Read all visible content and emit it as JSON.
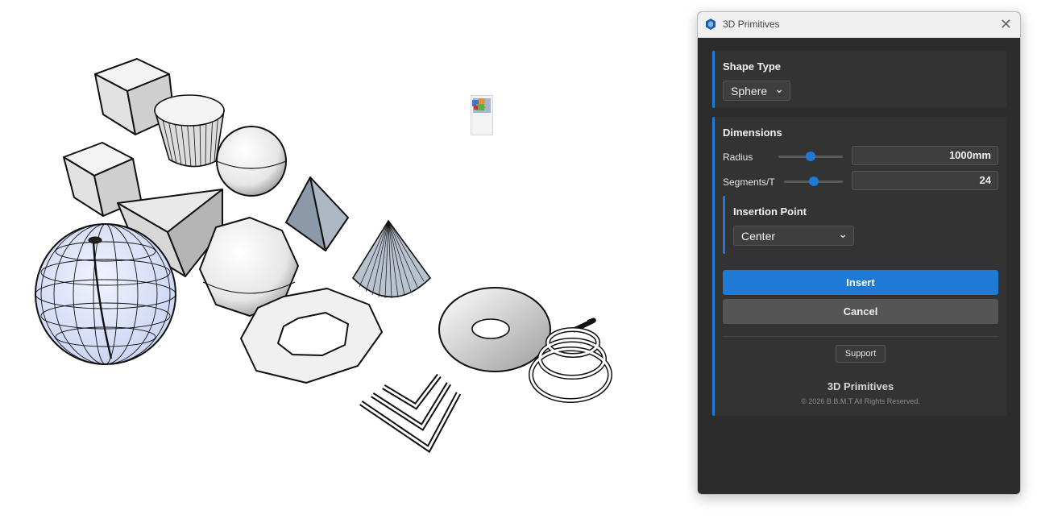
{
  "dialog": {
    "title": "3D Primitives",
    "shape_type": {
      "label": "Shape Type",
      "value": "Sphere"
    },
    "dimensions": {
      "label": "Dimensions",
      "radius": {
        "label": "Radius",
        "value": "1000mm",
        "slider_fraction": 0.5
      },
      "segments": {
        "label": "Segments/T",
        "value": "24",
        "slider_fraction": 0.5
      }
    },
    "insertion_point": {
      "label": "Insertion Point",
      "value": "Center"
    },
    "insert_label": "Insert",
    "cancel_label": "Cancel",
    "support_label": "Support",
    "footer_title": "3D Primitives",
    "footer_copyright": "© 2026 B.B.M.T All Rights Reserved.",
    "accent_color": "#1f7ad6"
  },
  "mini_toolbar": {
    "close_icon": "close-icon",
    "plugin_icon": "plugin-icon"
  }
}
